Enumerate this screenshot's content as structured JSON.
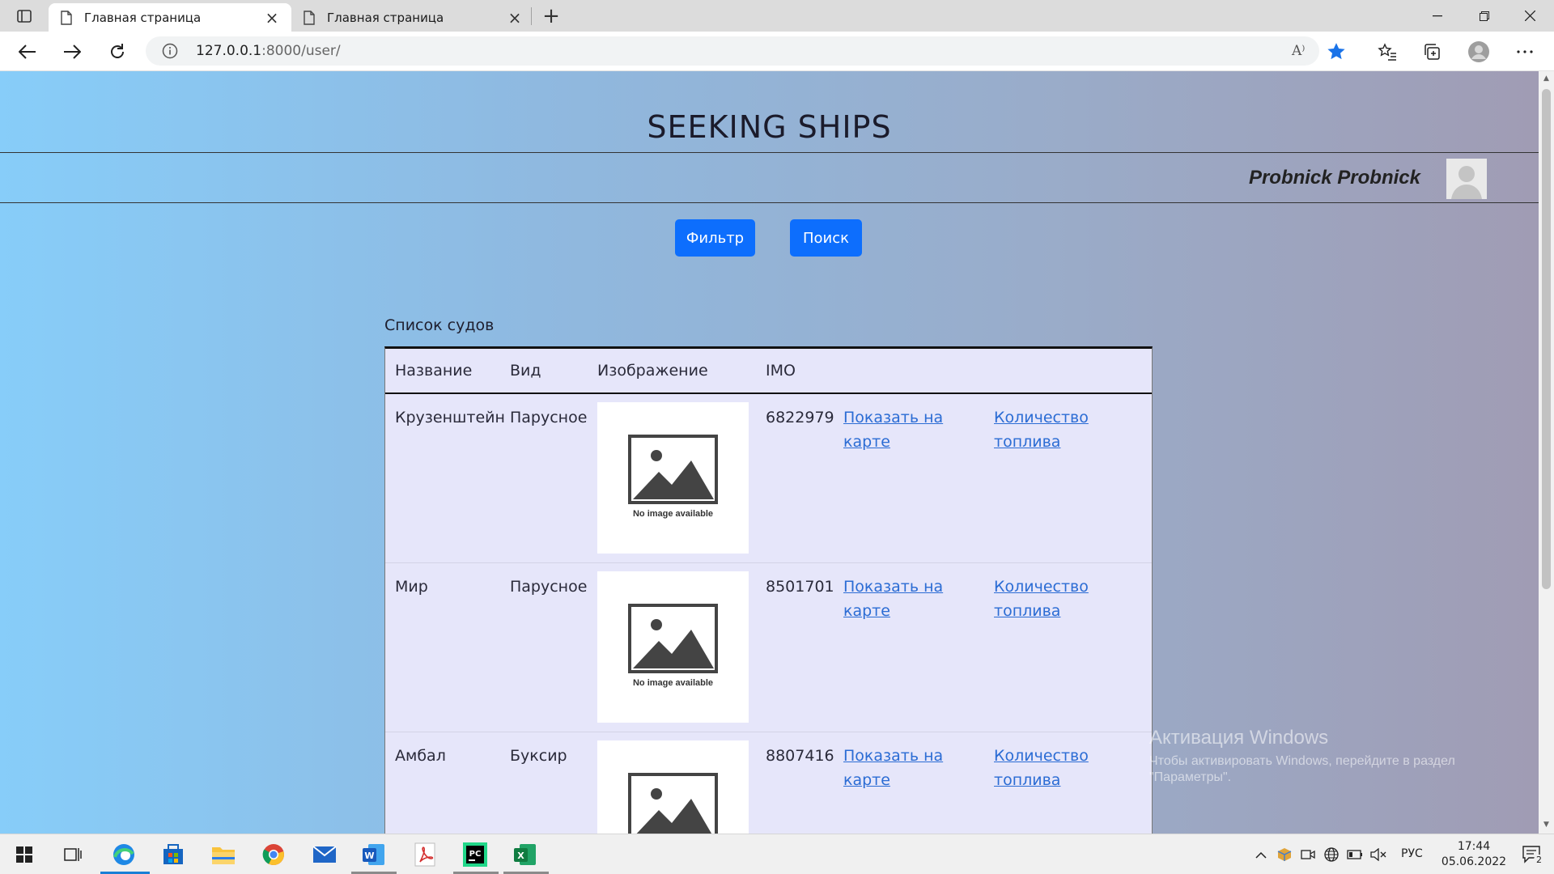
{
  "browser": {
    "tabs": [
      {
        "title": "Главная страница",
        "active": true
      },
      {
        "title": "Главная страница",
        "active": false
      }
    ],
    "url_host": "127.0.0.1",
    "url_rest": ":8000/user/",
    "read_aloud_label": "A⁾"
  },
  "site": {
    "title": "SEEKING SHIPS",
    "user_name": "Probnick Probnick",
    "buttons": {
      "filter": "Фильтр",
      "search": "Поиск"
    },
    "table_caption": "Список судов",
    "columns": [
      "Название",
      "Вид",
      "Изображение",
      "IMO"
    ],
    "no_image_text": "No image available",
    "rows": [
      {
        "name": "Крузенштейн",
        "type": "Парусное",
        "imo": "6822979",
        "map_link": "Показать на карте",
        "fuel_link": "Количество топлива"
      },
      {
        "name": "Мир",
        "type": "Парусное",
        "imo": "8501701",
        "map_link": "Показать на карте",
        "fuel_link": "Количество топлива"
      },
      {
        "name": "Амбал",
        "type": "Буксир",
        "imo": "8807416",
        "map_link": "Показать на карте",
        "fuel_link": "Количество топлива"
      }
    ]
  },
  "watermark": {
    "line1": "Активация Windows",
    "line2": "Чтобы активировать Windows, перейдите в раздел",
    "line3": "\"Параметры\"."
  },
  "taskbar": {
    "lang": "РУС",
    "time": "17:44",
    "date": "05.06.2022",
    "notifications": "2"
  },
  "colors": {
    "primary_button": "#0d6efd",
    "link": "#2b6cd4",
    "table_bg": "#e6e6fa"
  }
}
